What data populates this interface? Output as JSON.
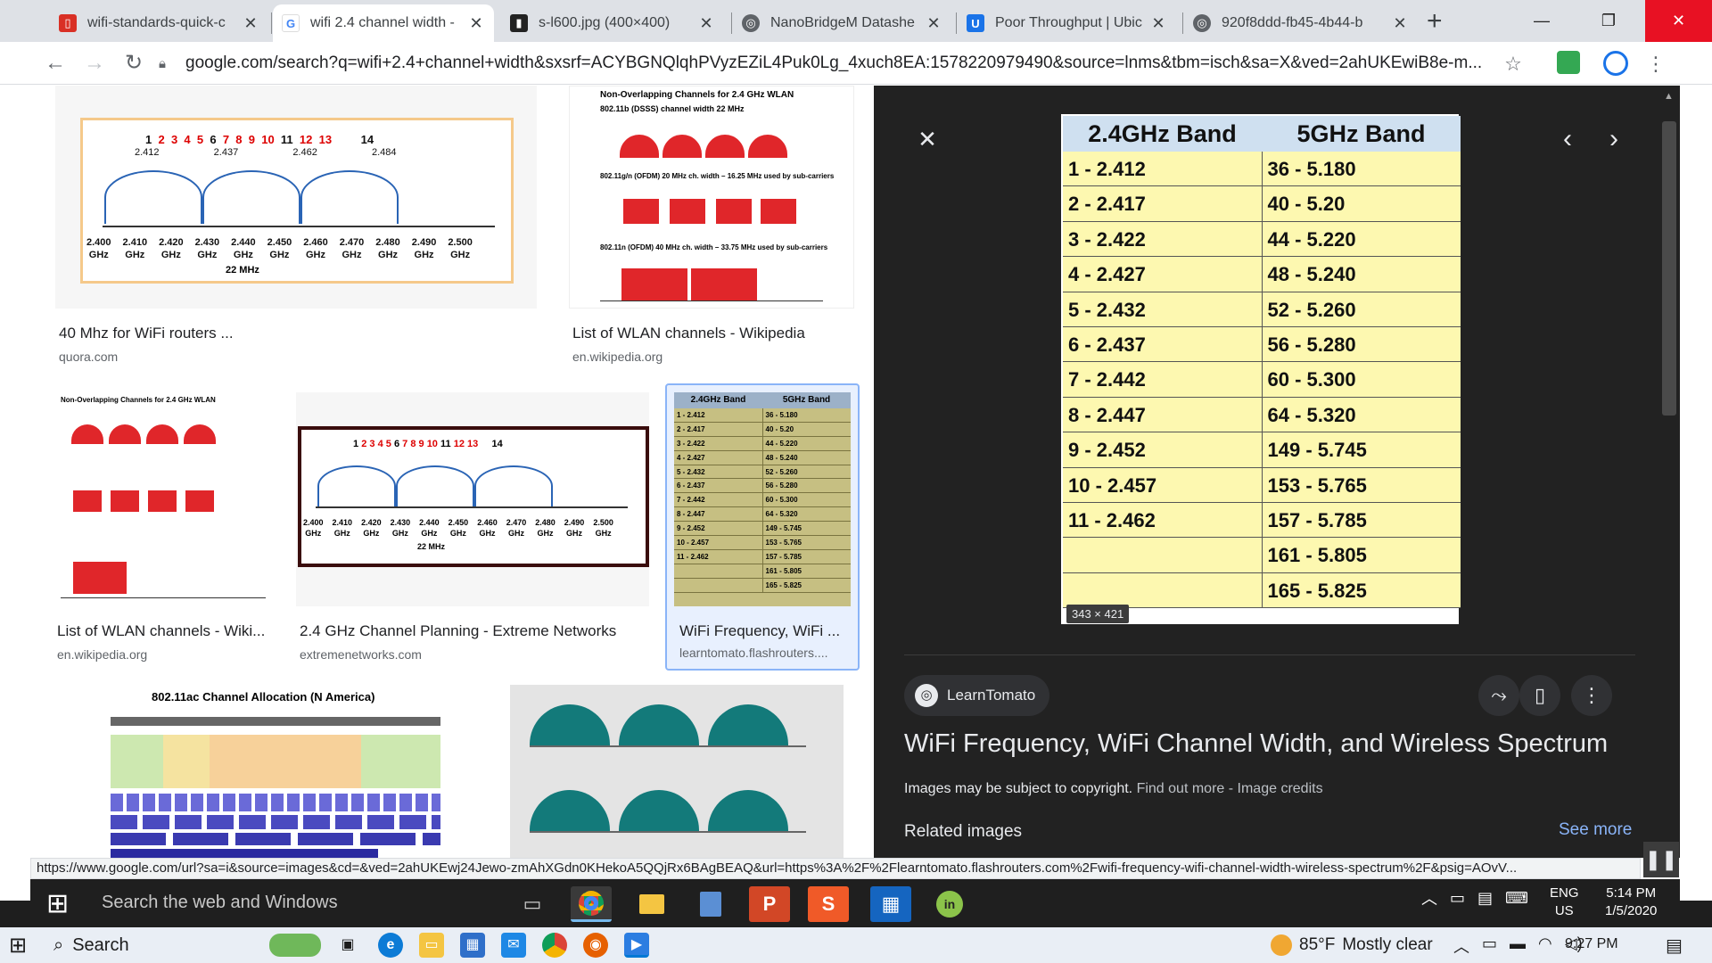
{
  "browser": {
    "tabs": [
      {
        "title": "wifi-standards-quick-c",
        "favicon": "pdf-icon",
        "color": "#d93025",
        "active": false
      },
      {
        "title": "wifi 2.4 channel width -",
        "favicon": "google-g-icon",
        "color": "#4285f4",
        "active": true
      },
      {
        "title": "s-l600.jpg (400×400)",
        "favicon": "ebay-icon",
        "color": "#222222",
        "active": false
      },
      {
        "title": "NanoBridgeM Datashe",
        "favicon": "globe-icon",
        "color": "#5f6368",
        "active": false
      },
      {
        "title": "Poor Throughput | Ubic",
        "favicon": "ubiquiti-u-icon",
        "color": "#1a73e8",
        "active": false
      },
      {
        "title": "920f8ddd-fb45-4b44-b",
        "favicon": "globe-icon",
        "color": "#5f6368",
        "active": false
      }
    ],
    "new_tab_label": "+",
    "url": "google.com/search?q=wifi+2.4+channel+width&sxsrf=ACYBGNQlqhPVyzEZiL4Puk0Lg_4xuch8EA:1578220979490&source=lnms&tbm=isch&sa=X&ved=2ahUKEwiB8e-m...",
    "status_url": "https://www.google.com/url?sa=i&source=images&cd=&ved=2ahUKEwj24Jewo-zmAhXGdn0KHekoA5QQjRx6BAgBEAQ&url=https%3A%2F%2Flearntomato.flashrouters.com%2Fwifi-frequency-wifi-channel-width-wireless-spectrum%2F&psig=AOvV..."
  },
  "results": [
    {
      "title": "40 Mhz for WiFi routers ...",
      "source": "quora.com",
      "thumb": "2.4ghz-arc-diagram"
    },
    {
      "title": "List of WLAN channels - Wikipedia",
      "source": "en.wikipedia.org",
      "thumb": "non-overlapping-channels-diagram"
    },
    {
      "title": "List of WLAN channels - Wiki...",
      "source": "en.wikipedia.org",
      "thumb": "non-overlapping-channels-diagram"
    },
    {
      "title": "2.4 GHz Channel Planning - Extreme Networks",
      "source": "extremenetworks.com",
      "thumb": "2.4ghz-arc-diagram"
    },
    {
      "title": "WiFi Frequency, WiFi ...",
      "source": "learntomato.flashrouters....",
      "thumb": "band-table",
      "selected": true
    },
    {
      "title": "",
      "source": "",
      "thumb": "802.11ac-channel-allocation"
    },
    {
      "title": "",
      "source": "",
      "thumb": "teal-channel-diagram"
    }
  ],
  "thumb_text": {
    "arc_channels": [
      "1",
      "2",
      "3",
      "4",
      "5",
      "6",
      "7",
      "8",
      "9",
      "10",
      "11",
      "12",
      "13",
      "14"
    ],
    "arc_freqs_top": [
      "2.412",
      "2.437",
      "2.462",
      "2.484"
    ],
    "arc_ghz": [
      "2.400\nGHz",
      "2.410\nGHz",
      "2.420\nGHz",
      "2.430\nGHz",
      "2.440\nGHz",
      "2.450\nGHz",
      "2.460\nGHz",
      "2.470\nGHz",
      "2.480\nGHz",
      "2.490\nGHz",
      "2.500\nGHz"
    ],
    "arc_width": "22 MHz",
    "wlan_title": "Non-Overlapping Channels for 2.4 GHz WLAN",
    "wlan_sub1": "802.11b (DSSS) channel width 22 MHz",
    "wlan_sub2": "802.11g/n (OFDM) 20 MHz ch. width – 16.25 MHz used by sub-carriers",
    "wlan_sub3": "802.11n (OFDM) 40 MHz ch. width – 33.75 MHz used by sub-carriers",
    "ac_title": "802.11ac Channel Allocation (N America)"
  },
  "preview": {
    "close_icon": "close-icon",
    "image_dims": "343 × 421",
    "table": {
      "headers": [
        "2.4GHz Band",
        "5GHz Band"
      ],
      "rows": [
        [
          "1 - 2.412",
          "36 - 5.180"
        ],
        [
          "2 - 2.417",
          "40 - 5.20"
        ],
        [
          "3 - 2.422",
          "44 - 5.220"
        ],
        [
          "4 - 2.427",
          "48 - 5.240"
        ],
        [
          "5 - 2.432",
          "52 - 5.260"
        ],
        [
          "6 - 2.437",
          "56 - 5.280"
        ],
        [
          "7 - 2.442",
          "60 - 5.300"
        ],
        [
          "8 - 2.447",
          "64 - 5.320"
        ],
        [
          "9 - 2.452",
          "149 - 5.745"
        ],
        [
          "10 - 2.457",
          "153 - 5.765"
        ],
        [
          "11 - 2.462",
          "157 - 5.785"
        ],
        [
          "",
          "161 - 5.805"
        ],
        [
          "",
          "165 - 5.825"
        ]
      ]
    },
    "source_name": "LearnTomato",
    "title": "WiFi Frequency, WiFi Channel Width, and Wireless Spectrum",
    "copyright": "Images may be subject to copyright.",
    "find_out_more": "Find out more",
    "sep": "-",
    "image_credits": "Image credits",
    "related": "Related images",
    "see_more": "See more"
  },
  "taskbar_inner": {
    "search_placeholder": "Search the web and Windows",
    "lang": "ENG",
    "region": "US",
    "time": "5:14 PM",
    "date": "1/5/2020"
  },
  "taskbar_outer": {
    "search_label": "Search",
    "temperature": "85°F",
    "weather": "Mostly clear",
    "time": "9:27 PM"
  }
}
